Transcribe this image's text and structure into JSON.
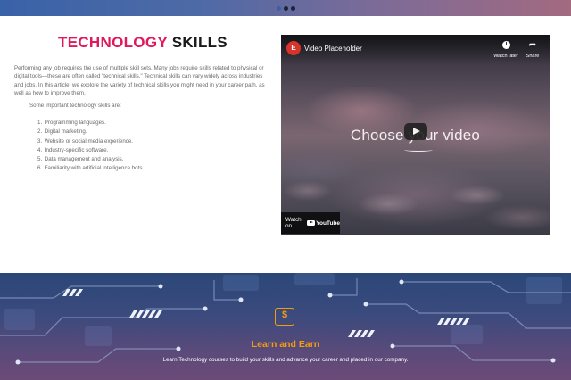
{
  "header": {
    "carousel_dots": 3,
    "gradient": [
      "#3a62a8",
      "#a36a80"
    ]
  },
  "article": {
    "title_accent": "TECHNOLOGY",
    "title_rest": "SKILLS",
    "accent_color": "#e0195a",
    "intro": "Performing any job requires the use of multiple skill sets. Many jobs require skills related to physical or digital tools—these are often called \"technical skills.\" Technical skills can vary widely across industries and jobs. In this article, we explore the variety of technical skills you might need in your career path, as well as how to improve them.",
    "subhead": "Some  important technology skills are:",
    "skills": [
      {
        "num": "1.",
        "label": "Programming languages."
      },
      {
        "num": "2.",
        "label": "Digital marketing."
      },
      {
        "num": "3.",
        "label": "Website or social media experience."
      },
      {
        "num": "4.",
        "label": "Industry-specific software."
      },
      {
        "num": "5.",
        "label": "Data management and analysis."
      },
      {
        "num": "6.",
        "label": "Familiarity with artificial intelligence bots."
      }
    ]
  },
  "video": {
    "channel_icon": "elementor-logo-icon",
    "title": "Video Placeholder",
    "watch_later": "Watch later",
    "share": "Share",
    "overlay_text_a": "Choose ",
    "overlay_text_b": "your",
    "overlay_text_c": " video",
    "watch_on": "Watch on",
    "youtube": "YouTube"
  },
  "banner": {
    "icon": "money-icon",
    "title": "Learn and Earn",
    "text": "Learn Technology courses to build your skills and advance your career and placed in our company.",
    "title_color": "#f39c12"
  }
}
